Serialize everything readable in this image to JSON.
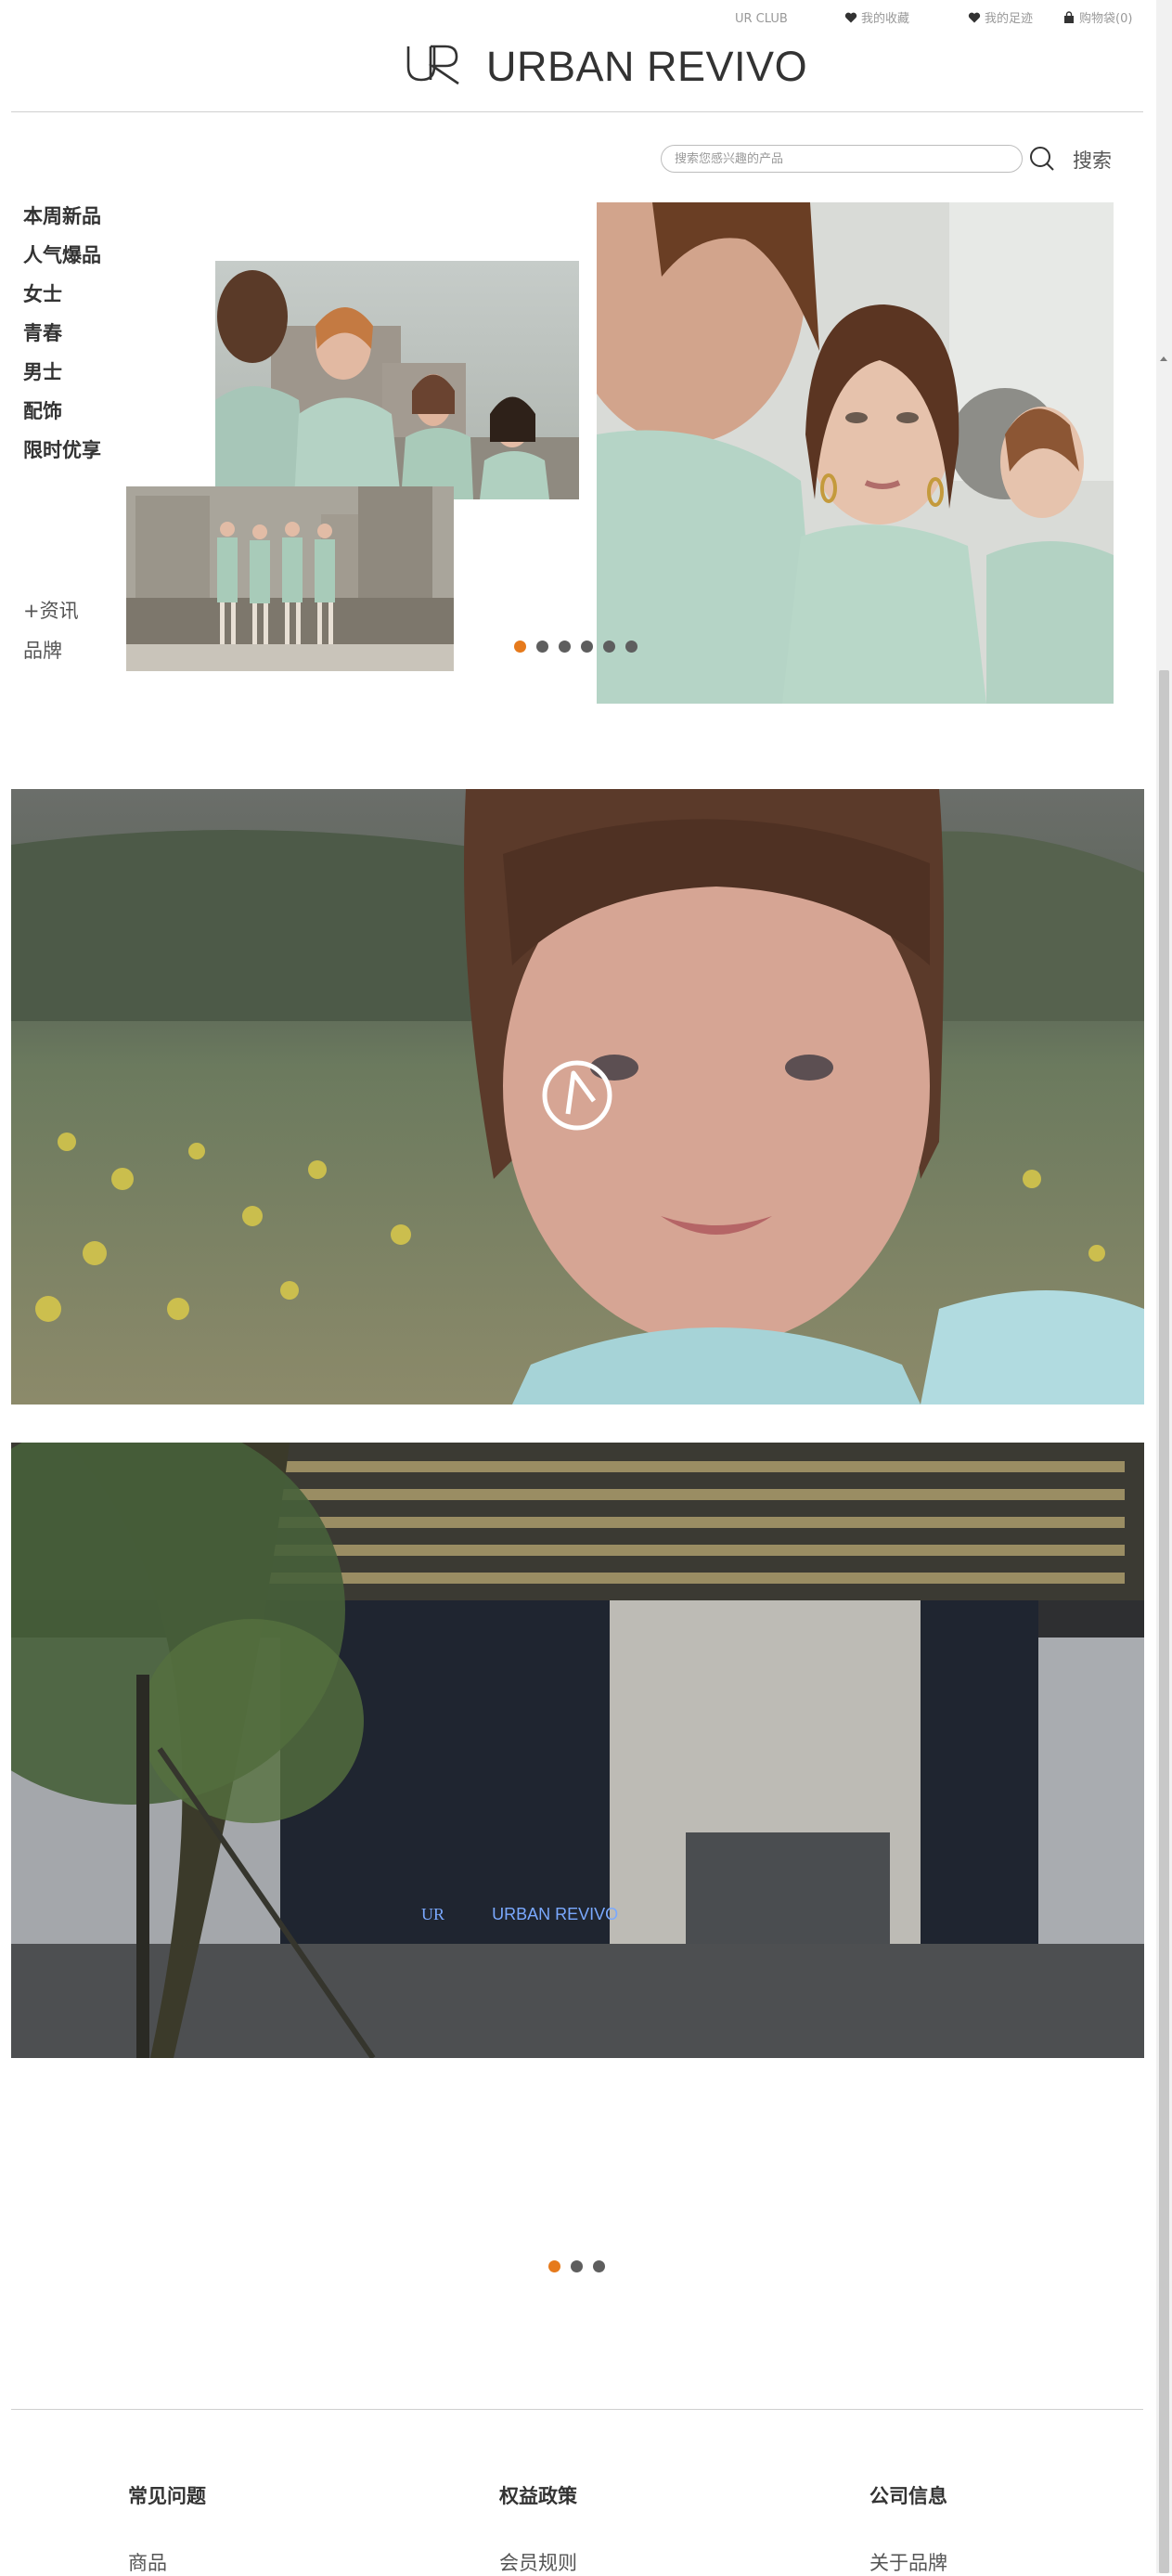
{
  "top_links": {
    "club": "UR CLUB",
    "favorites": "我的收藏",
    "footprint": "我的足迹",
    "cart": "购物袋(0)"
  },
  "brand": {
    "name": "URBAN REVIVO",
    "mark": "UR"
  },
  "search": {
    "placeholder": "搜索您感兴趣的产品",
    "button": "搜索"
  },
  "side_nav": {
    "items": [
      "本周新品",
      "人气爆品",
      "女士",
      "青春",
      "男士",
      "配饰",
      "限时优享"
    ],
    "news": "+资讯",
    "brand": "品牌"
  },
  "hero_carousel": {
    "slide_count": 6,
    "active_index": 0
  },
  "store_banner_sign": {
    "mark": "UR",
    "name": "URBAN REVIVO"
  },
  "lower_carousel": {
    "slide_count": 3,
    "active_index": 0
  },
  "footer": {
    "columns": [
      {
        "title": "常见问题",
        "first_link": "商品"
      },
      {
        "title": "权益政策",
        "first_link": "会员规则"
      },
      {
        "title": "公司信息",
        "first_link": "关于品牌"
      }
    ]
  },
  "colors": {
    "accent": "#e67a1c",
    "dot": "#5e5e5e",
    "divider": "#cfcfcf"
  }
}
